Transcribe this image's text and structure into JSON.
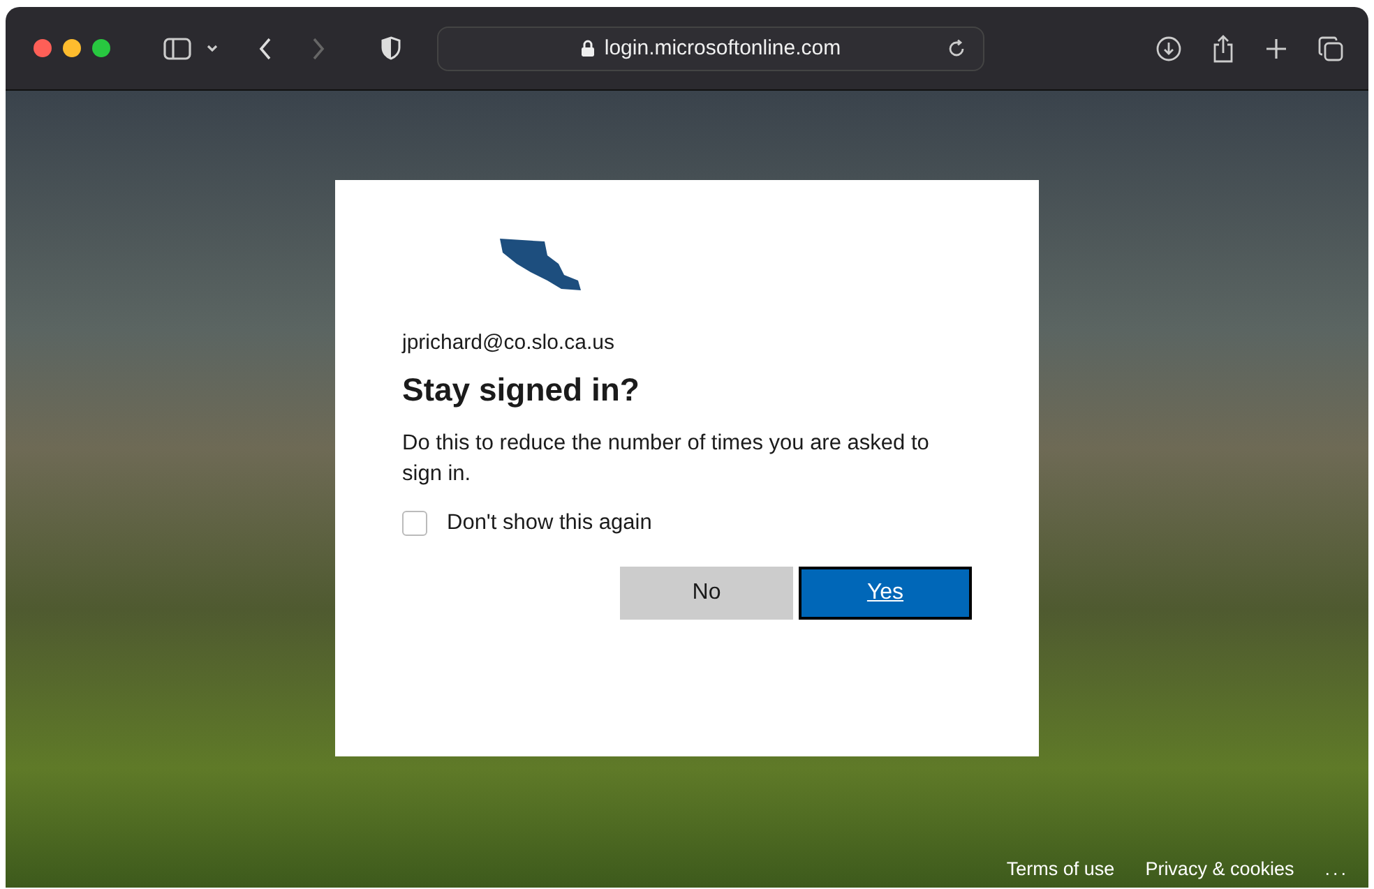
{
  "browser": {
    "url": "login.microsoftonline.com"
  },
  "dialog": {
    "account": "jprichard@co.slo.ca.us",
    "title": "Stay signed in?",
    "description": "Do this to reduce the number of times you are asked to sign in.",
    "checkbox": {
      "label": "Don't show this again",
      "checked": false
    },
    "buttons": [
      {
        "label": "No",
        "kind": "secondary"
      },
      {
        "label": "Yes",
        "kind": "primary"
      }
    ]
  },
  "footer": {
    "links": [
      "Terms of use",
      "Privacy & cookies"
    ],
    "more": "..."
  }
}
